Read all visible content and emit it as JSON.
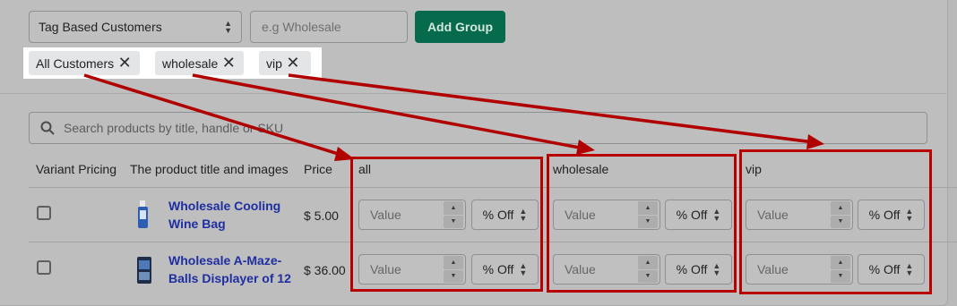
{
  "toolbar": {
    "customer_type": "Tag Based Customers",
    "tag_placeholder": "e.g Wholesale",
    "add_group_label": "Add Group"
  },
  "tags": [
    "All Customers",
    "wholesale",
    "vip"
  ],
  "search": {
    "placeholder": "Search products by title, handle or SKU"
  },
  "table": {
    "headers": {
      "variant_pricing": "Variant Pricing",
      "title": "The product title and images",
      "price": "Price",
      "group_all": "all",
      "group_wholesale": "wholesale",
      "group_vip": "vip"
    },
    "rows": [
      {
        "title_line1": "Wholesale Cooling",
        "title_line2": "Wine Bag",
        "price": "$ 5.00"
      },
      {
        "title_line1": "Wholesale A-Maze-",
        "title_line2": "Balls Displayer of 12",
        "price": "$ 36.00"
      }
    ],
    "value_placeholder": "Value",
    "discount_type": "% Off"
  },
  "icons": {
    "search": "search-icon",
    "remove_tag": "close-icon",
    "select_arrows": "up-down-icon",
    "stepper": "stepper-icon"
  },
  "colors": {
    "accent": "#066b4c",
    "link": "#1f2ea0",
    "annotation": "#b80000",
    "highlight": "#ffffff"
  }
}
